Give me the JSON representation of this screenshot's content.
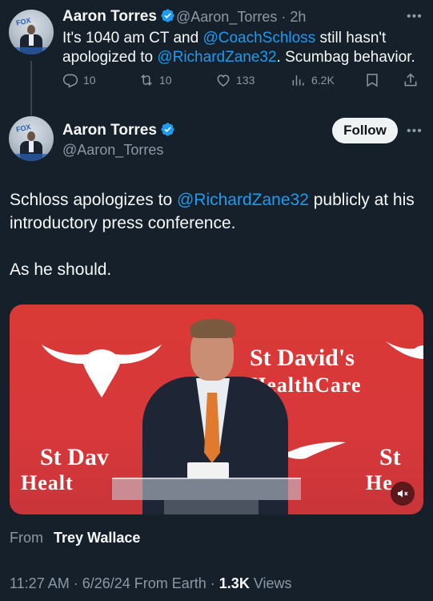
{
  "reply_tweet": {
    "author_name": "Aaron Torres",
    "author_handle": "@Aaron_Torres",
    "time_ago": "· 2h",
    "text_parts": [
      "It's 1040 am CT and ",
      "@CoachSchloss",
      " still hasn't apologized to ",
      "@RichardZane32",
      ". Scumbag behavior."
    ],
    "replies": "10",
    "reposts": "10",
    "likes": "133",
    "views": "6.2K"
  },
  "main_tweet": {
    "author_name": "Aaron Torres",
    "author_handle": "@Aaron_Torres",
    "follow_label": "Follow",
    "text_line1_parts": [
      "Schloss apologizes to ",
      "@RichardZane32",
      " publicly at his introductory press conference."
    ],
    "text_line2": "As he should.",
    "from_label": "From",
    "from_name": "Trey Wallace",
    "timestamp": "11:27 AM · 6/26/24 From Earth ·",
    "views_count": "1.3K",
    "views_label": "Views"
  },
  "video": {
    "logo_line1": "St David's",
    "logo_line2": "HealthCare",
    "logo_left1": "St Dav",
    "logo_left2": "Healt",
    "logo_right1": "St",
    "logo_right2": "He"
  },
  "icons": {
    "verified": "verified-badge-icon",
    "more": "more-icon",
    "reply": "reply-icon",
    "repost": "repost-icon",
    "like": "like-icon",
    "views": "views-icon",
    "bookmark": "bookmark-icon",
    "share": "share-icon",
    "mute": "mute-icon"
  },
  "colors": {
    "background": "#15202b",
    "mention": "#1d9bf0",
    "secondary_text": "#8b98a5",
    "video_bg": "#d93a36"
  }
}
